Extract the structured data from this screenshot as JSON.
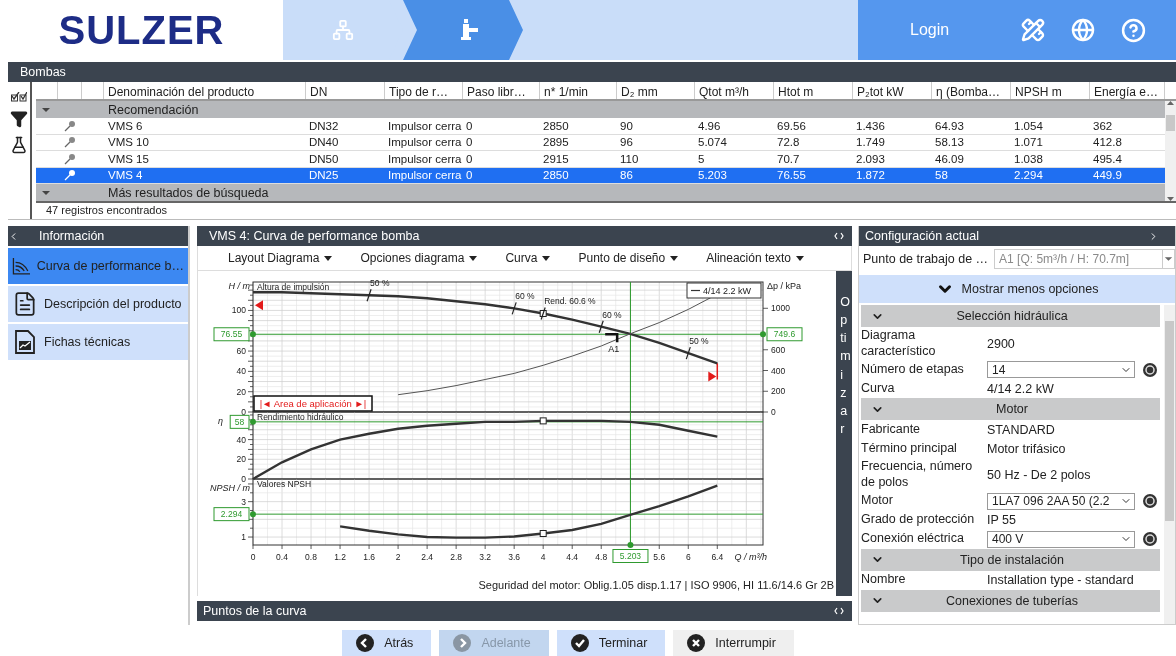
{
  "header": {
    "logo": "SULZER",
    "steps": [
      {
        "kind": "network",
        "selected": false
      },
      {
        "kind": "pump",
        "selected": true
      }
    ],
    "login": "Login"
  },
  "pumps_panel": {
    "title": "Bombas",
    "columns": [
      "Denominación del producto",
      "DN",
      "Tipo de r…",
      "Paso libr…",
      "n* 1/min",
      "D₂ mm",
      "Qtot m³/h",
      "Htot m",
      "P₂tot kW",
      "η (Bomba…",
      "NPSH m",
      "Energía e…"
    ],
    "rows": [
      {
        "kind": "group",
        "label": "Recomendación",
        "expanded": true
      },
      {
        "kind": "row",
        "selected": false,
        "cells": [
          "VMS 6",
          "DN32",
          "Impulsor cerra",
          "0",
          "2850",
          "90",
          "4.96",
          "69.56",
          "1.436",
          "64.93",
          "1.054",
          "362"
        ]
      },
      {
        "kind": "row",
        "selected": false,
        "cells": [
          "VMS 10",
          "DN40",
          "Impulsor cerra",
          "0",
          "2895",
          "96",
          "5.074",
          "72.8",
          "1.749",
          "58.13",
          "1.071",
          "412.8"
        ]
      },
      {
        "kind": "row",
        "selected": false,
        "cells": [
          "VMS 15",
          "DN50",
          "Impulsor cerra",
          "0",
          "2915",
          "110",
          "5",
          "70.7",
          "2.093",
          "46.09",
          "1.038",
          "495.4"
        ]
      },
      {
        "kind": "row",
        "selected": true,
        "cells": [
          "VMS 4",
          "DN25",
          "Impulsor cerra",
          "0",
          "2850",
          "86",
          "5.203",
          "76.55",
          "1.872",
          "58",
          "2.294",
          "449.9"
        ]
      },
      {
        "kind": "group",
        "label": "Más resultados de búsqueda",
        "expanded": true
      }
    ],
    "status": "47 registros encontrados"
  },
  "info_panel": {
    "title": "Información",
    "items": [
      {
        "label": "Curva de performance b…",
        "kind": "curve",
        "selected": true
      },
      {
        "label": "Descripción del producto",
        "kind": "document",
        "selected": false
      },
      {
        "label": "Fichas técnicas",
        "kind": "datasheet",
        "selected": false
      }
    ]
  },
  "chart_panel": {
    "title": "VMS 4: Curva de performance bomba",
    "menus": [
      "Layout Diagrama",
      "Opciones diagrama",
      "Curva",
      "Punto de diseño",
      "Alineación texto"
    ],
    "side_button": "Optimizar",
    "plots": [
      {
        "range_label": "|◄ Area de aplicación ►|",
        "operating_point_label": "A1",
        "chart_data": {
          "type": "line",
          "title": "Altura de impulsión",
          "ylabel": "H / m",
          "y2label": "Δp / kPa",
          "grid": true,
          "x": [
            0,
            0.4,
            0.8,
            1.2,
            1.6,
            2,
            2.4,
            2.8,
            3.2,
            3.6,
            4,
            4.4,
            4.8,
            5.2,
            5.6,
            6,
            6.4
          ],
          "xlim": [
            0,
            7.03
          ],
          "ylim": [
            0,
            128
          ],
          "y2lim": [
            0,
            1253.4
          ],
          "yticks": [
            0,
            20,
            40,
            60,
            100
          ],
          "y2ticks": [
            0,
            200,
            400,
            600,
            1000
          ],
          "series": [
            {
              "name": "4/14 2.2 kW",
              "color": "#333333",
              "values": [
                118,
                118,
                117,
                116,
                115,
                114,
                112,
                109,
                106,
                102,
                97,
                91,
                84,
                77,
                68,
                58,
                48
              ]
            },
            {
              "color": "#555555",
              "values": [
                null,
                null,
                null,
                null,
                null,
                17,
                21,
                26,
                32,
                38,
                46,
                55,
                65,
                77,
                88,
                101,
                116
              ]
            }
          ],
          "annotations": [
            {
              "text": "50 %",
              "x": 1.6,
              "y": 115
            },
            {
              "text": "60 %",
              "x": 3.6,
              "y": 102
            },
            {
              "text": "Rend.  60.6 %",
              "x": 4,
              "y": 97
            },
            {
              "text": "60 %",
              "x": 4.8,
              "y": 84
            },
            {
              "text": "50 %",
              "x": 6,
              "y": 58
            },
            "749.6"
          ],
          "ref_lines": [
            {
              "axis": "x",
              "value": 5.203
            },
            {
              "axis": "y",
              "value": 76.55,
              "label": "76.55"
            }
          ]
        }
      },
      {
        "chart_data": {
          "type": "line",
          "title": "Rendimiento hidráulico",
          "ylabel": "η",
          "grid": true,
          "x": [
            0,
            0.4,
            0.8,
            1.2,
            1.6,
            2,
            2.4,
            2.8,
            3.2,
            3.6,
            4,
            4.4,
            4.8,
            5.2,
            5.6,
            6,
            6.4
          ],
          "xlim": [
            0,
            7.03
          ],
          "ylim": [
            0,
            68
          ],
          "yticks": [
            0,
            20,
            40
          ],
          "series": [
            {
              "color": "#333333",
              "values": [
                0,
                17,
                30,
                40,
                46,
                51,
                54,
                56,
                58,
                58,
                59,
                59,
                59,
                58,
                55,
                49,
                43
              ]
            }
          ],
          "ref_lines": [
            {
              "axis": "x",
              "value": 5.203
            },
            {
              "axis": "y",
              "value": 58,
              "label": "58"
            }
          ]
        }
      },
      {
        "chart_data": {
          "type": "line",
          "title": "Valores NPSH",
          "ylabel": "NPSH / m",
          "xlabel": "Q / m³/h",
          "grid": true,
          "x": [
            1.2,
            1.6,
            2,
            2.4,
            2.8,
            3.2,
            3.6,
            4,
            4.4,
            4.8,
            5.2,
            5.6,
            6,
            6.4
          ],
          "xlim": [
            0,
            7.03
          ],
          "ylim": [
            0.55,
            4.28
          ],
          "yticks": [
            1,
            3
          ],
          "xticks": [
            0,
            0.4,
            0.8,
            1.2,
            1.6,
            2,
            2.4,
            2.8,
            3.2,
            3.6,
            4,
            4.4,
            4.8,
            5.6,
            6,
            6.4
          ],
          "series": [
            {
              "color": "#333333",
              "values": [
                1.6,
                1.35,
                1.15,
                1.0,
                0.97,
                0.97,
                1.03,
                1.2,
                1.4,
                1.75,
                2.25,
                2.75,
                3.3,
                3.9
              ]
            }
          ],
          "ref_lines": [
            {
              "axis": "x",
              "value": 5.203,
              "label": "5.203"
            },
            {
              "axis": "y",
              "value": 2.294,
              "label": "2.294"
            }
          ]
        }
      }
    ],
    "footnote": "Seguridad del motor: Oblig.1.05 disp.1.17 | ISO 9906, HI 11.6/14.6 Gr 2B"
  },
  "curve_points_panel": {
    "title": "Puntos de la curva"
  },
  "config_panel": {
    "title": "Configuración actual",
    "work_point": {
      "label": "Punto de trabajo de …",
      "value": "A1 [Q: 5m³/h / H: 70.7m]",
      "disabled": true
    },
    "toggle": "Mostrar menos opciones",
    "sections": [
      {
        "title": "Selección hidráulica",
        "expanded": true,
        "rows": [
          {
            "kind": "text",
            "label": "Diagrama característico",
            "value": "2900"
          },
          {
            "kind": "select",
            "label": "Número de etapas",
            "value": "14"
          },
          {
            "kind": "text",
            "label": "Curva",
            "value": "4/14 2.2 kW"
          }
        ]
      },
      {
        "title": "Motor",
        "expanded": true,
        "rows": [
          {
            "kind": "text",
            "label": "Fabricante",
            "value": "STANDARD"
          },
          {
            "kind": "text",
            "label": "Término principal",
            "value": "Motor trifásico"
          },
          {
            "kind": "text",
            "label": "Frecuencia, número de polos",
            "value": "50 Hz - De 2 polos"
          },
          {
            "kind": "select",
            "label": "Motor",
            "value": "1LA7 096 2AA 50 (2.2"
          },
          {
            "kind": "text",
            "label": "Grado de protección",
            "value": "IP 55"
          },
          {
            "kind": "select",
            "label": "Conexión eléctrica",
            "value": "400 V"
          }
        ]
      },
      {
        "title": "Tipo de instalación",
        "expanded": true,
        "rows": [
          {
            "kind": "text",
            "label": "Nombre",
            "value": "Installation type - standard"
          }
        ]
      },
      {
        "title": "Conexiones de tuberías",
        "expanded": true
      }
    ]
  },
  "buttons": [
    {
      "kind": "back",
      "label": "Atrás",
      "disabled": false
    },
    {
      "kind": "forward",
      "label": "Adelante",
      "disabled": true
    },
    {
      "kind": "finish",
      "label": "Terminar",
      "disabled": false
    },
    {
      "kind": "cancel",
      "label": "Interrumpir",
      "disabled": false
    }
  ]
}
